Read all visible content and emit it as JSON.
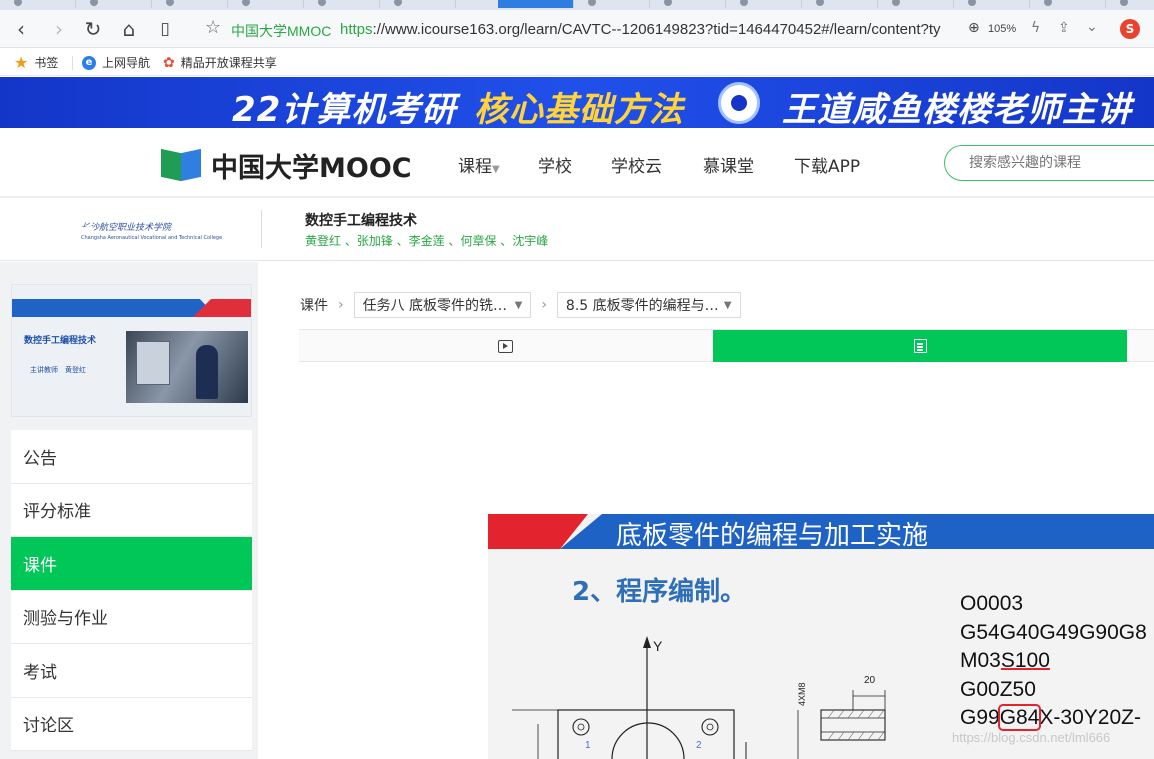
{
  "browser": {
    "site_name": "中国大学MMOC",
    "url_scheme": "https",
    "url_rest": "://www.icourse163.org/learn/CAVTC--1206149823?tid=1464470452#/learn/content?ty",
    "zoom": "105%",
    "ext_label": "S"
  },
  "bookmarks": [
    {
      "label": "书签",
      "icon": "star-icon"
    },
    {
      "label": "上网导航",
      "icon": "ie-icon"
    },
    {
      "label": "精品开放课程共享",
      "icon": "flower-icon"
    }
  ],
  "banner": {
    "part1": "22计算机考研",
    "part2": "核心基础方法",
    "part3": "王道咸鱼楼楼老师主讲",
    "colors": {
      "bg": "#1a3fd6",
      "highlight": "#ffd43a"
    }
  },
  "header": {
    "logo_text": "中国大学MOOC",
    "nav": [
      "课程",
      "学校",
      "学校云",
      "慕课堂",
      "下载APP"
    ],
    "search_placeholder": "搜索感兴趣的课程"
  },
  "course": {
    "school_name_cn": "长沙航空职业技术学院",
    "school_name_en": "Changsha Aeronautical Vocational and Technical College",
    "title": "数控手工编程技术",
    "teachers": "黄登红 、张加锋 、李金莲 、何章保 、沈宇峰",
    "thumb_title": "数控手工编程技术",
    "thumb_lecturer": "主讲教师　黄登红"
  },
  "sidebar": {
    "items": [
      "公告",
      "评分标准",
      "课件",
      "测验与作业",
      "考试",
      "讨论区"
    ],
    "active": "课件"
  },
  "breadcrumb": {
    "root": "课件",
    "chapter": "任务八 底板零件的铣…",
    "lesson": "8.5 底板零件的编程与…"
  },
  "slide": {
    "title": "底板零件的编程与加工实施",
    "section": "2、程序编制。",
    "axis_label": "Y",
    "dim_label": "20",
    "thread_label": "4XM8",
    "mark_1": "1",
    "mark_2": "2",
    "code_lines": [
      {
        "pre": "O0003",
        "mark": "",
        "post": ""
      },
      {
        "pre": "G54G40G49G90G8",
        "mark": "",
        "post": ""
      },
      {
        "pre": "M03",
        "mark": "S100",
        "post": ""
      },
      {
        "pre": "G00Z50",
        "mark": "",
        "post": ""
      },
      {
        "pre": "G99",
        "mark": "G84",
        "post": "X-30Y20Z-"
      }
    ]
  },
  "watermark": "https://blog.csdn.net/lml666",
  "colors": {
    "accent_green": "#00c758",
    "link_green": "#2aa745",
    "slide_blue": "#1d62c4",
    "slide_red": "#e3232d"
  }
}
